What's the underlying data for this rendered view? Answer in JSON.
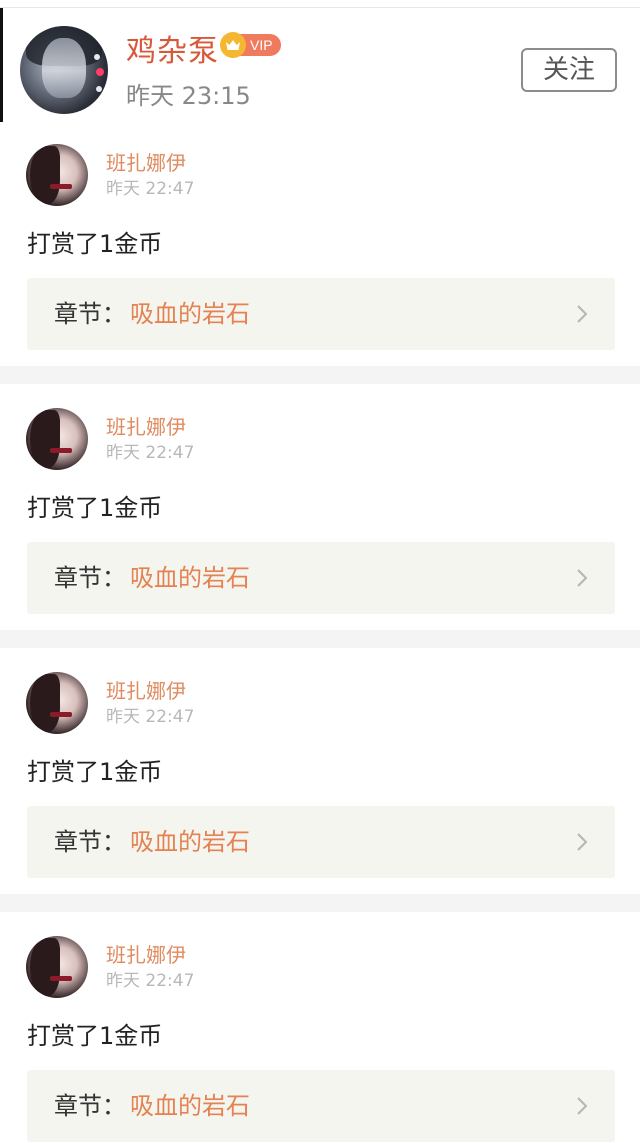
{
  "header": {
    "name": "鸡杂泵",
    "vip_label": "VIP",
    "time": "昨天 23:15",
    "follow_label": "关注"
  },
  "cards": [
    {
      "username": "班扎娜伊",
      "time": "昨天 22:47",
      "message": "打赏了1金币",
      "chapter_label": "章节：",
      "chapter_title": "吸血的岩石"
    },
    {
      "username": "班扎娜伊",
      "time": "昨天 22:47",
      "message": "打赏了1金币",
      "chapter_label": "章节：",
      "chapter_title": "吸血的岩石"
    },
    {
      "username": "班扎娜伊",
      "time": "昨天 22:47",
      "message": "打赏了1金币",
      "chapter_label": "章节：",
      "chapter_title": "吸血的岩石"
    },
    {
      "username": "班扎娜伊",
      "time": "昨天 22:47",
      "message": "打赏了1金币",
      "chapter_label": "章节：",
      "chapter_title": "吸血的岩石"
    }
  ],
  "colors": {
    "name_accent": "#d8583a",
    "username_accent": "#e08a5e",
    "chapter_accent": "#e48252",
    "vip_badge": "#f07a5e",
    "separator": "#f4f4f4"
  },
  "icons": {
    "crown": "crown-icon",
    "chevron": "chevron-right-icon"
  }
}
